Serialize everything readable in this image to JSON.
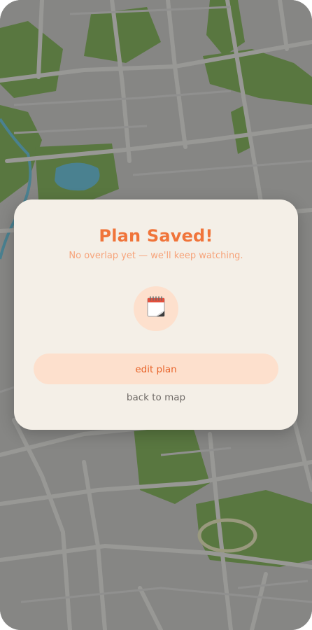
{
  "modal": {
    "title": "Plan Saved!",
    "subtitle": "No overlap yet — we'll keep watching.",
    "icon": "calendar-icon",
    "primary_button_label": "edit plan",
    "secondary_link_label": "back to map"
  },
  "colors": {
    "accent": "#f0743a",
    "subtitle": "#f6a37a",
    "button_bg": "#fde0cd",
    "modal_bg": "#f4efe7",
    "map_park": "#5e7f43",
    "map_water": "#4f8a9a"
  }
}
